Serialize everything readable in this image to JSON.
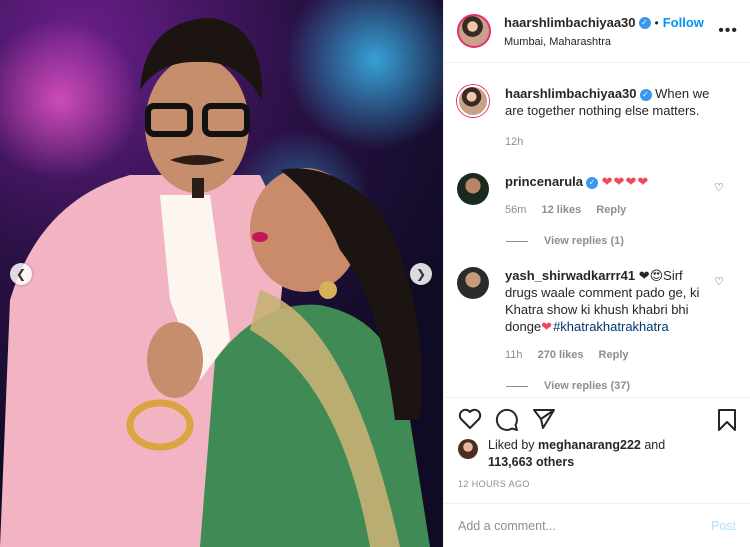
{
  "author": {
    "username": "haarshlimbachiyaa30",
    "follow_label": "Follow",
    "location": "Mumbai, Maharashtra"
  },
  "caption": {
    "username": "haarshlimbachiyaa30",
    "text": "When we are together nothing else matters.",
    "time": "12h"
  },
  "comments": [
    {
      "username": "princenarula",
      "hearts": "❤❤❤❤",
      "time": "56m",
      "likes": "12 likes",
      "reply": "Reply",
      "view_replies": "View replies (1)"
    },
    {
      "username": "yash_shirwadkarrr41",
      "text_start": "❤😍Sirf drugs waale comment pado ge, ki Khatra show ki khush khabri bhi donge",
      "heart_inline": "❤",
      "hashtag": "#khatrakhatrakhatra",
      "time": "11h",
      "likes": "270 likes",
      "reply": "Reply",
      "view_replies": "View replies (37)"
    }
  ],
  "likes": {
    "prefix": "Liked by",
    "user": "meghanarang222",
    "conj": "and",
    "others": "113,663 others"
  },
  "timestamp": "12 HOURS AGO",
  "add_comment": {
    "placeholder": "Add a comment...",
    "post_label": "Post"
  },
  "colors": {
    "accent": "#0095f6",
    "heart": "#ed4956",
    "verified": "#3897f0"
  }
}
